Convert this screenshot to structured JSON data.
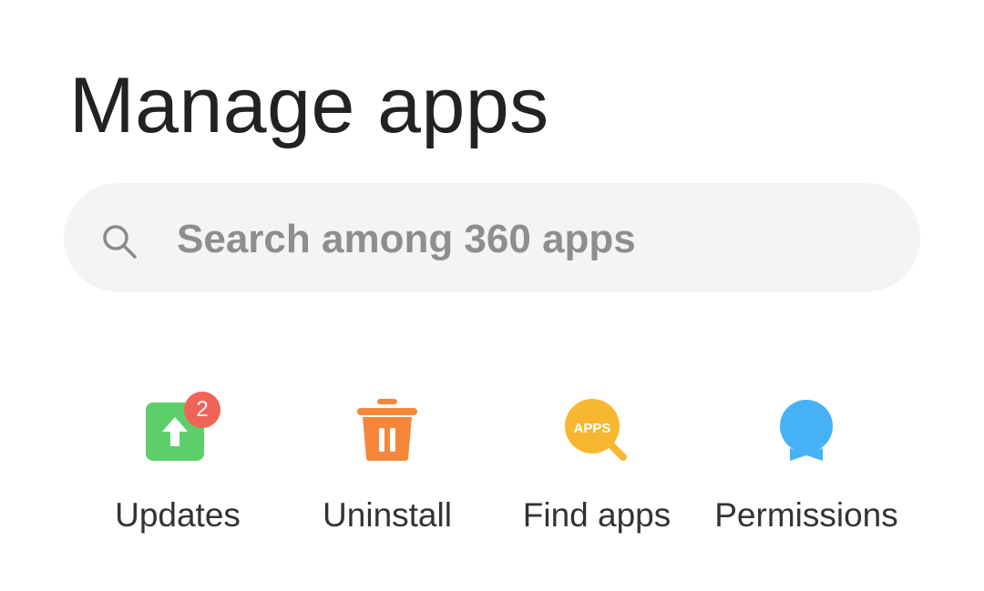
{
  "header": {
    "title": "Manage apps"
  },
  "search": {
    "placeholder": "Search among 360 apps",
    "icon": "search-icon"
  },
  "actions": [
    {
      "label": "Updates",
      "icon": "upload-arrow-icon",
      "color": "#5dcf6a",
      "badge": "2",
      "badge_color": "#f06457"
    },
    {
      "label": "Uninstall",
      "icon": "trash-icon",
      "color": "#f5873a"
    },
    {
      "label": "Find apps",
      "icon": "find-apps-icon",
      "color": "#f7b731",
      "icon_text": "APPS"
    },
    {
      "label": "Permissions",
      "icon": "permissions-icon",
      "color": "#46b1f5"
    }
  ]
}
